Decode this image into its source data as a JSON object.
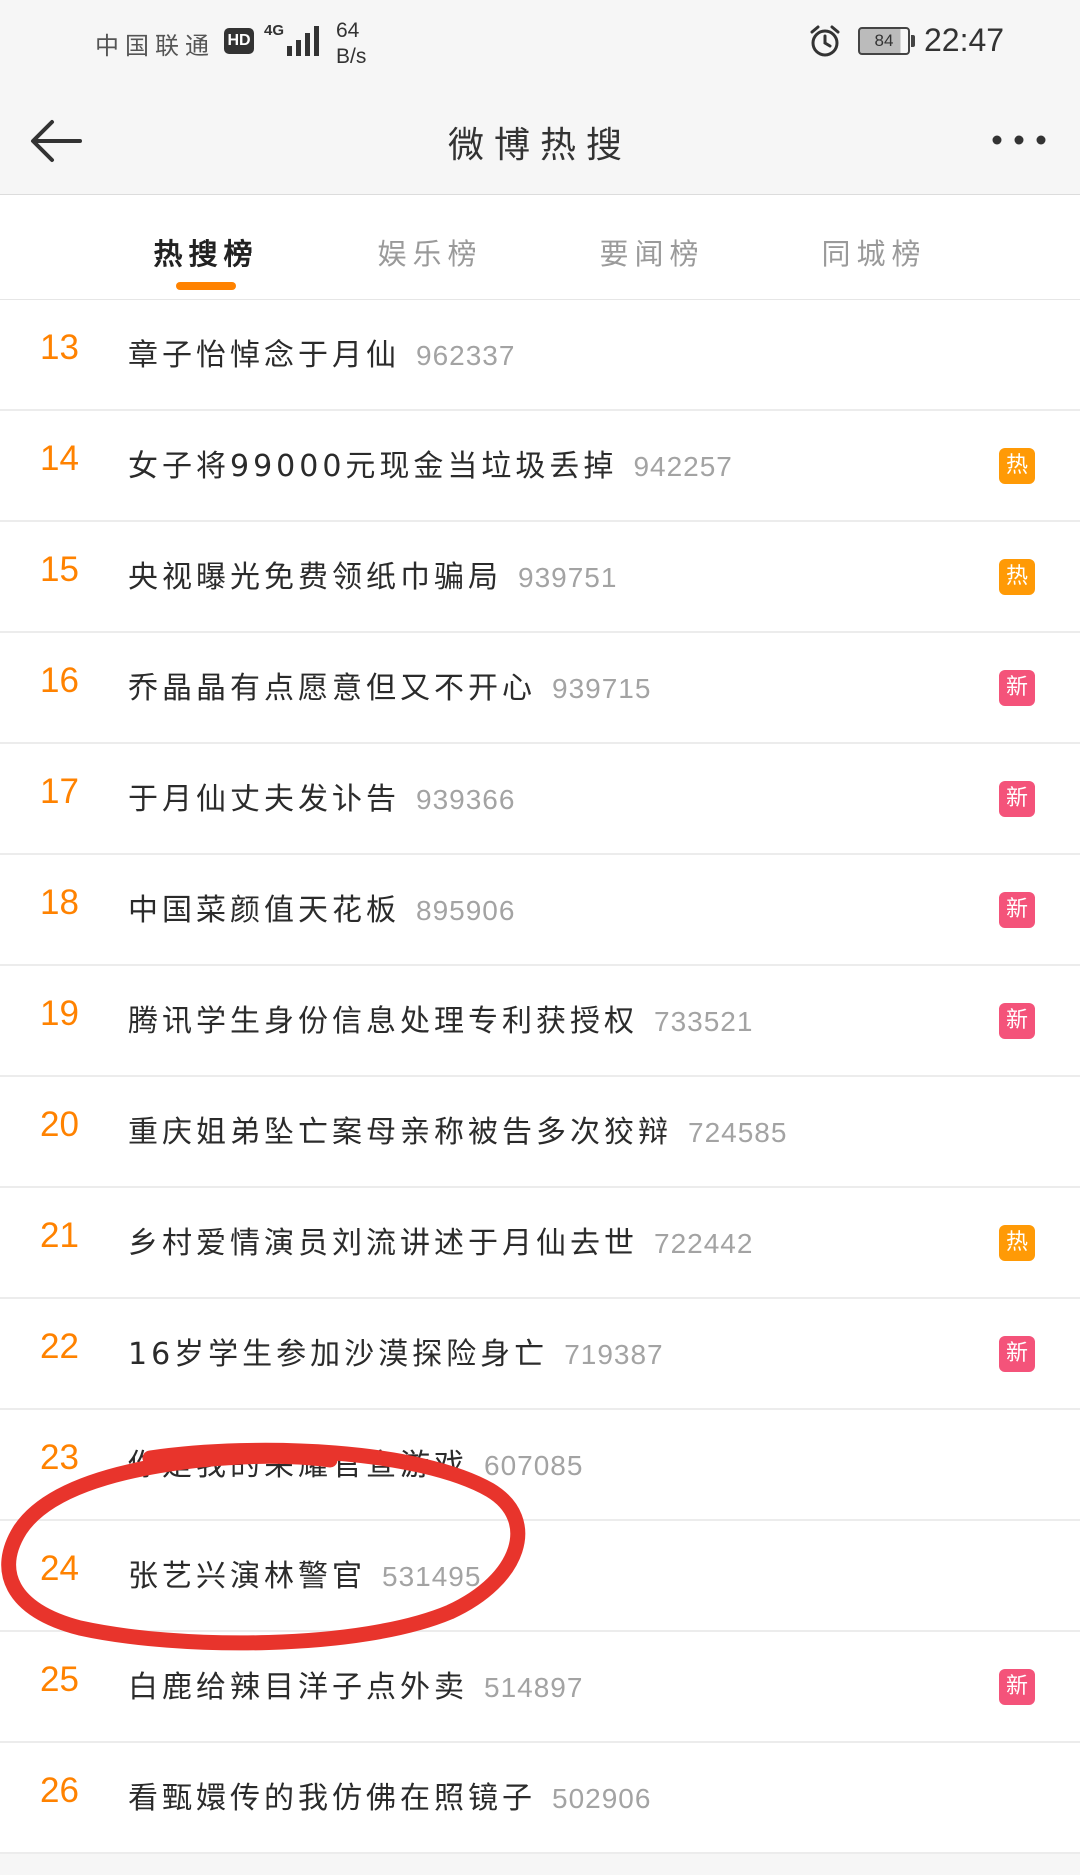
{
  "status_bar": {
    "carrier": "中国联通",
    "hd": "HD",
    "network": "4G",
    "net_speed_value": "64",
    "net_speed_unit": "B/s",
    "battery": "84",
    "battery_level": 0.84,
    "time": "22:47"
  },
  "nav": {
    "title": "微博热搜"
  },
  "tabs": [
    {
      "label": "热搜榜",
      "active": true
    },
    {
      "label": "娱乐榜",
      "active": false
    },
    {
      "label": "要闻榜",
      "active": false
    },
    {
      "label": "同城榜",
      "active": false
    }
  ],
  "colors": {
    "accent": "#ff8200",
    "hot_badge": "#ff9a06",
    "new_badge": "#f4537a",
    "marker": "#e8342c"
  },
  "items": [
    {
      "rank": "13",
      "title": "章子怡悼念于月仙",
      "count": "962337",
      "badge": ""
    },
    {
      "rank": "14",
      "title": "女子将99000元现金当垃圾丢掉",
      "count": "942257",
      "badge": "热"
    },
    {
      "rank": "15",
      "title": "央视曝光免费领纸巾骗局",
      "count": "939751",
      "badge": "热"
    },
    {
      "rank": "16",
      "title": "乔晶晶有点愿意但又不开心",
      "count": "939715",
      "badge": "新"
    },
    {
      "rank": "17",
      "title": "于月仙丈夫发讣告",
      "count": "939366",
      "badge": "新"
    },
    {
      "rank": "18",
      "title": "中国菜颜值天花板",
      "count": "895906",
      "badge": "新"
    },
    {
      "rank": "19",
      "title": "腾讯学生身份信息处理专利获授权",
      "count": "733521",
      "badge": "新"
    },
    {
      "rank": "20",
      "title": "重庆姐弟坠亡案母亲称被告多次狡辩",
      "count": "724585",
      "badge": ""
    },
    {
      "rank": "21",
      "title": "乡村爱情演员刘流讲述于月仙去世",
      "count": "722442",
      "badge": "热"
    },
    {
      "rank": "22",
      "title": "16岁学生参加沙漠探险身亡",
      "count": "719387",
      "badge": "新"
    },
    {
      "rank": "23",
      "title": "你是我的荣耀官宣游戏",
      "count": "607085",
      "badge": ""
    },
    {
      "rank": "24",
      "title": "张艺兴演林警官",
      "count": "531495",
      "badge": ""
    },
    {
      "rank": "25",
      "title": "白鹿给辣目洋子点外卖",
      "count": "514897",
      "badge": "新"
    },
    {
      "rank": "26",
      "title": "看甄嬛传的我仿佛在照镜子",
      "count": "502906",
      "badge": ""
    }
  ]
}
